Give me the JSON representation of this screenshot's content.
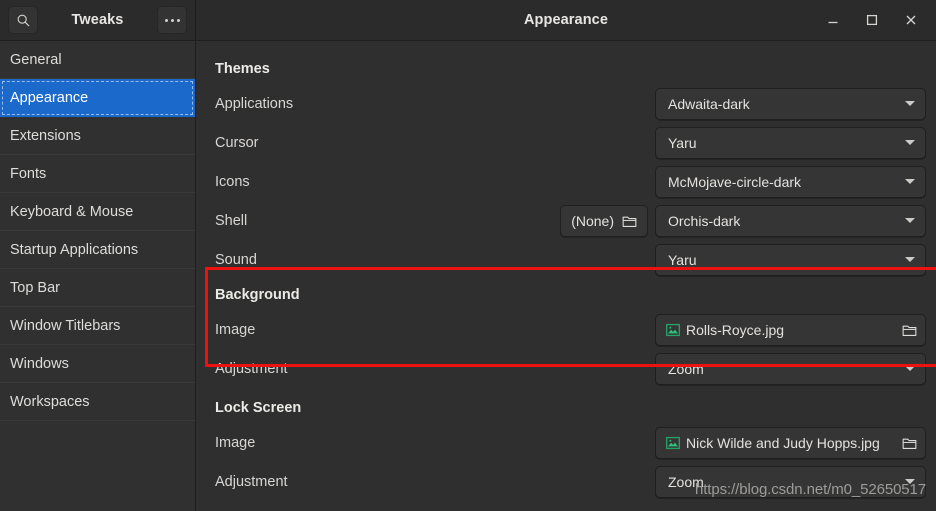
{
  "window": {
    "app_title": "Tweaks",
    "page_title": "Appearance",
    "search_icon": "search-icon",
    "menu_icon": "hamburger-dots-icon",
    "controls": {
      "minimize": "minimize-icon",
      "maximize": "maximize-icon",
      "close": "close-icon"
    }
  },
  "sidebar": {
    "items": [
      {
        "label": "General",
        "selected": false
      },
      {
        "label": "Appearance",
        "selected": true
      },
      {
        "label": "Extensions",
        "selected": false
      },
      {
        "label": "Fonts",
        "selected": false
      },
      {
        "label": "Keyboard & Mouse",
        "selected": false
      },
      {
        "label": "Startup Applications",
        "selected": false
      },
      {
        "label": "Top Bar",
        "selected": false
      },
      {
        "label": "Window Titlebars",
        "selected": false
      },
      {
        "label": "Windows",
        "selected": false
      },
      {
        "label": "Workspaces",
        "selected": false
      }
    ]
  },
  "content": {
    "themes": {
      "title": "Themes",
      "rows": [
        {
          "label": "Applications",
          "value": "Adwaita-dark",
          "type": "combo"
        },
        {
          "label": "Cursor",
          "value": "Yaru",
          "type": "combo"
        },
        {
          "label": "Icons",
          "value": "McMojave-circle-dark",
          "type": "combo"
        },
        {
          "label": "Shell",
          "value": "Orchis-dark",
          "type": "combo",
          "extra_button": "(None)",
          "extra_icon": "folder-icon"
        },
        {
          "label": "Sound",
          "value": "Yaru",
          "type": "combo"
        }
      ]
    },
    "background": {
      "title": "Background",
      "rows": [
        {
          "label": "Image",
          "value": "Rolls-Royce.jpg",
          "type": "file",
          "icon": "image-file-icon",
          "trailing_icon": "folder-icon"
        },
        {
          "label": "Adjustment",
          "value": "Zoom",
          "type": "combo"
        }
      ]
    },
    "lock_screen": {
      "title": "Lock Screen",
      "rows": [
        {
          "label": "Image",
          "value": "Nick Wilde and Judy Hopps.jpg",
          "type": "file",
          "icon": "image-file-icon",
          "trailing_icon": "folder-icon"
        },
        {
          "label": "Adjustment",
          "value": "Zoom",
          "type": "combo"
        }
      ]
    }
  },
  "annotation": {
    "highlight_color": "#ee1111",
    "highlight_target": "Background"
  },
  "watermark": {
    "text": "https://blog.csdn.net/m0_52650517"
  },
  "colors": {
    "window_bg": "#2f2f2f",
    "headerbar_bg": "#2b2b2b",
    "sidebar_bg": "#303030",
    "selection_blue": "#1b6acb",
    "control_bg": "#353535",
    "text_primary": "#e4e2df",
    "image_icon_green": "#26a269"
  }
}
